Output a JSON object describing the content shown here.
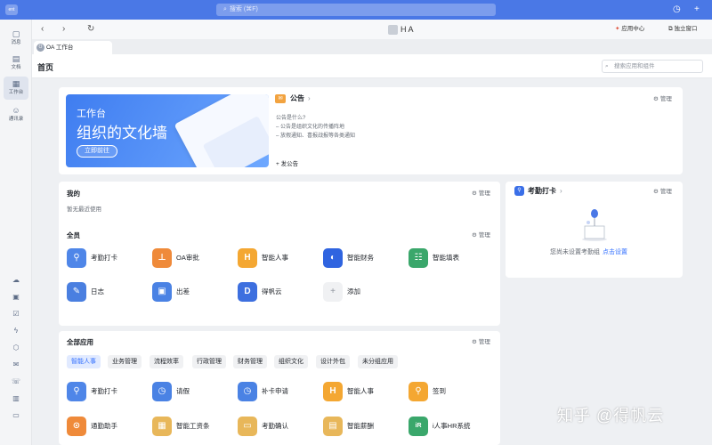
{
  "topbar": {
    "logo": "ent",
    "search_placeholder": "搜索 (⌘F)"
  },
  "sidebar": {
    "items": [
      {
        "label": "消息",
        "icon": "message-icon"
      },
      {
        "label": "文档",
        "icon": "document-icon"
      },
      {
        "label": "工作台",
        "icon": "workbench-icon"
      },
      {
        "label": "通讯录",
        "icon": "contacts-icon"
      }
    ]
  },
  "navbar": {
    "title": "H A",
    "app_center": "应用中心",
    "standalone": "独立窗口"
  },
  "tabs": [
    {
      "label": "OA 工作台"
    }
  ],
  "header": {
    "title": "首页",
    "search_placeholder": "搜索应用和组件"
  },
  "banner": {
    "line1": "工作台",
    "line2": "组织的文化墙",
    "button": "立即前往"
  },
  "announcement": {
    "title": "公告",
    "lines": [
      "公告是什么?",
      "– 公告是组织文化的传播阵地",
      "– 放假通知、喜报战报等各类通知"
    ],
    "post": "+ 发公告",
    "manage": "管理"
  },
  "mine": {
    "title": "我的",
    "empty": "暂无最近使用",
    "manage": "管理"
  },
  "all_staff": {
    "title": "全员",
    "manage": "管理",
    "apps": [
      {
        "label": "考勤打卡",
        "color": "#4f86e8",
        "glyph": "⚲"
      },
      {
        "label": "OA审批",
        "color": "#ef8a3a",
        "glyph": "⊥"
      },
      {
        "label": "智能人事",
        "color": "#f4a732",
        "glyph": "H"
      },
      {
        "label": "智能财务",
        "color": "#2f64e0",
        "glyph": "◐"
      },
      {
        "label": "智能填表",
        "color": "#3aa76b",
        "glyph": "☷"
      },
      {
        "label": "日志",
        "color": "#4a7fe0",
        "glyph": "✎"
      },
      {
        "label": "出差",
        "color": "#4a82e4",
        "glyph": "▣"
      },
      {
        "label": "得帆云",
        "color": "#3d6fdf",
        "glyph": "D"
      },
      {
        "label": "添加",
        "color": "#f0f1f3",
        "glyph": "+"
      }
    ]
  },
  "all_apps": {
    "title": "全部应用",
    "manage": "管理",
    "categories": [
      "智能人事",
      "业务管理",
      "流程效率",
      "行政管理",
      "财务管理",
      "组织文化",
      "设计外包",
      "未分组应用"
    ],
    "apps": [
      {
        "label": "考勤打卡",
        "color": "#4f86e8",
        "glyph": "⚲"
      },
      {
        "label": "请假",
        "color": "#4a82e4",
        "glyph": "◷"
      },
      {
        "label": "补卡申请",
        "color": "#4a82e4",
        "glyph": "◷"
      },
      {
        "label": "智能人事",
        "color": "#f4a732",
        "glyph": "H"
      },
      {
        "label": "签到",
        "color": "#f4a732",
        "glyph": "⚲"
      },
      {
        "label": "通勤助手",
        "color": "#ef8a3a",
        "glyph": "⊙"
      },
      {
        "label": "智能工资条",
        "color": "#e8b75a",
        "glyph": "▦"
      },
      {
        "label": "考勤确认",
        "color": "#e8b75a",
        "glyph": "▭"
      },
      {
        "label": "智能薪酬",
        "color": "#e8b75a",
        "glyph": "▤"
      },
      {
        "label": "i人事HR系统",
        "color": "#3aa76b",
        "glyph": "iR"
      }
    ]
  },
  "attendance": {
    "title": "考勤打卡",
    "manage": "管理",
    "empty_text": "您尚未设置考勤组",
    "link": "点击设置"
  },
  "watermark": "知乎 @得帆云"
}
